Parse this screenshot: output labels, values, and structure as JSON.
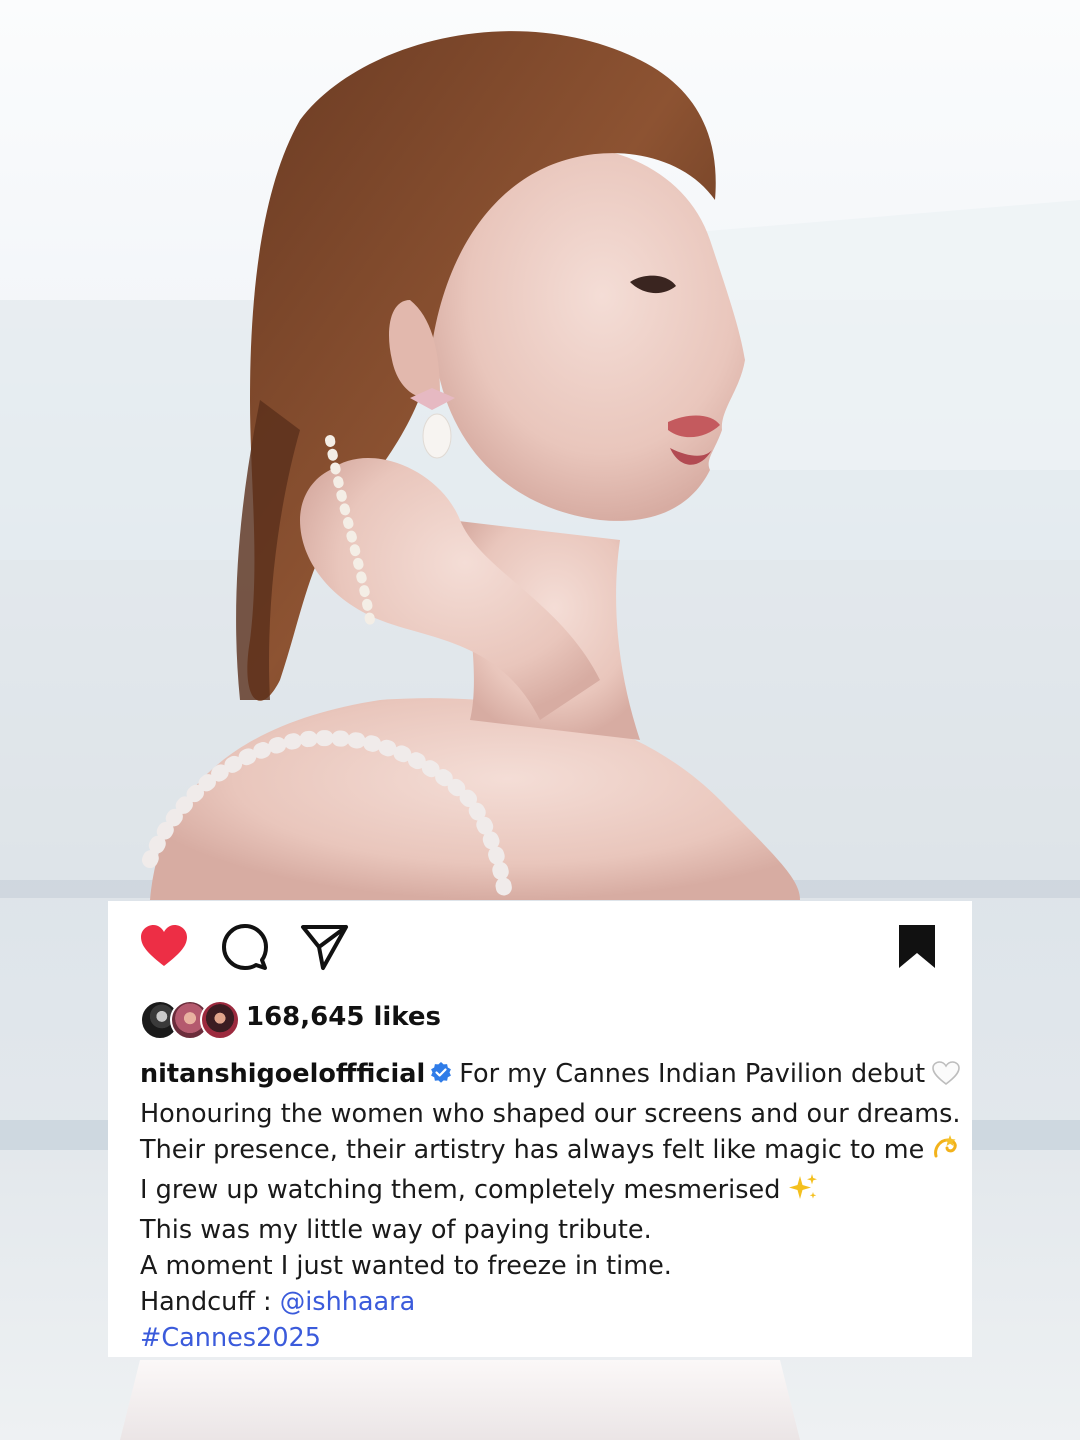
{
  "post": {
    "likes": {
      "count_text": "168,645 likes",
      "avatars": [
        "liker-avatar-1",
        "liker-avatar-2",
        "liker-avatar-3"
      ]
    },
    "actions": {
      "like_icon": "heart-icon",
      "comment_icon": "comment-icon",
      "share_icon": "send-icon",
      "save_icon": "bookmark-icon",
      "liked": true
    },
    "caption": {
      "username": "nitanshigoeloffficial",
      "verified": true,
      "lines": [
        "For my Cannes Indian Pavilion debut",
        "Honouring the women who shaped our screens and our dreams.",
        "Their presence, their artistry has always felt like magic to me",
        "I grew up watching them, completely mesmerised",
        "This was my little way of paying tribute.",
        "A moment I just wanted to freeze in time."
      ],
      "credit_label": "Handcuff : ",
      "mention": "@ishhaara",
      "hashtag": "#Cannes2025"
    }
  },
  "colors": {
    "heart": "#ed2e45",
    "link": "#3b5bdb",
    "verified": "#2f7ce8",
    "text": "#1a1a1a"
  }
}
